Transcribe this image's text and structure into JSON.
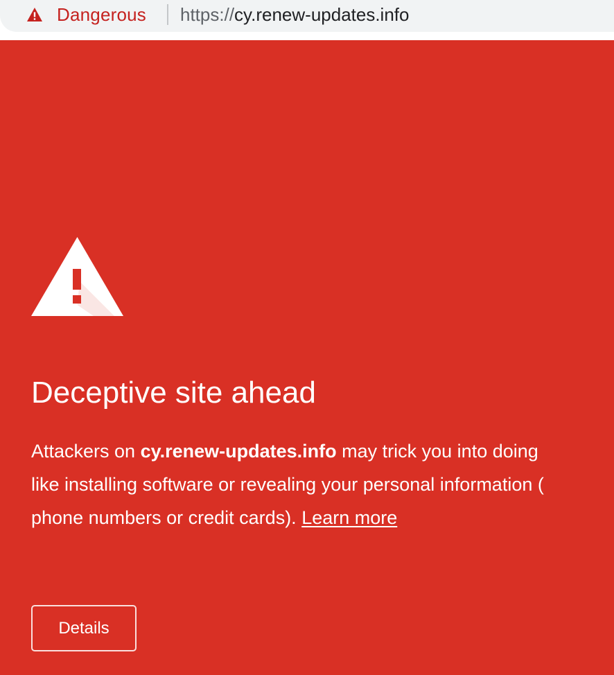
{
  "browser": {
    "security_chip": {
      "icon": "warning-triangle-icon",
      "label": "Dangerous",
      "color": "#c5221f"
    },
    "url": {
      "scheme": "https://",
      "host": "cy.renew-updates.info"
    }
  },
  "interstitial": {
    "background_color": "#d93025",
    "icon": "warning-triangle-icon",
    "heading": "Deceptive site ahead",
    "body": {
      "line1_prefix": "Attackers on ",
      "line1_host": "cy.renew-updates.info",
      "line1_suffix": " may trick you into doing",
      "line2": "like installing software or revealing your personal information (",
      "line3_prefix": "phone numbers or credit cards). ",
      "learn_more": "Learn more"
    },
    "details_button": "Details"
  }
}
